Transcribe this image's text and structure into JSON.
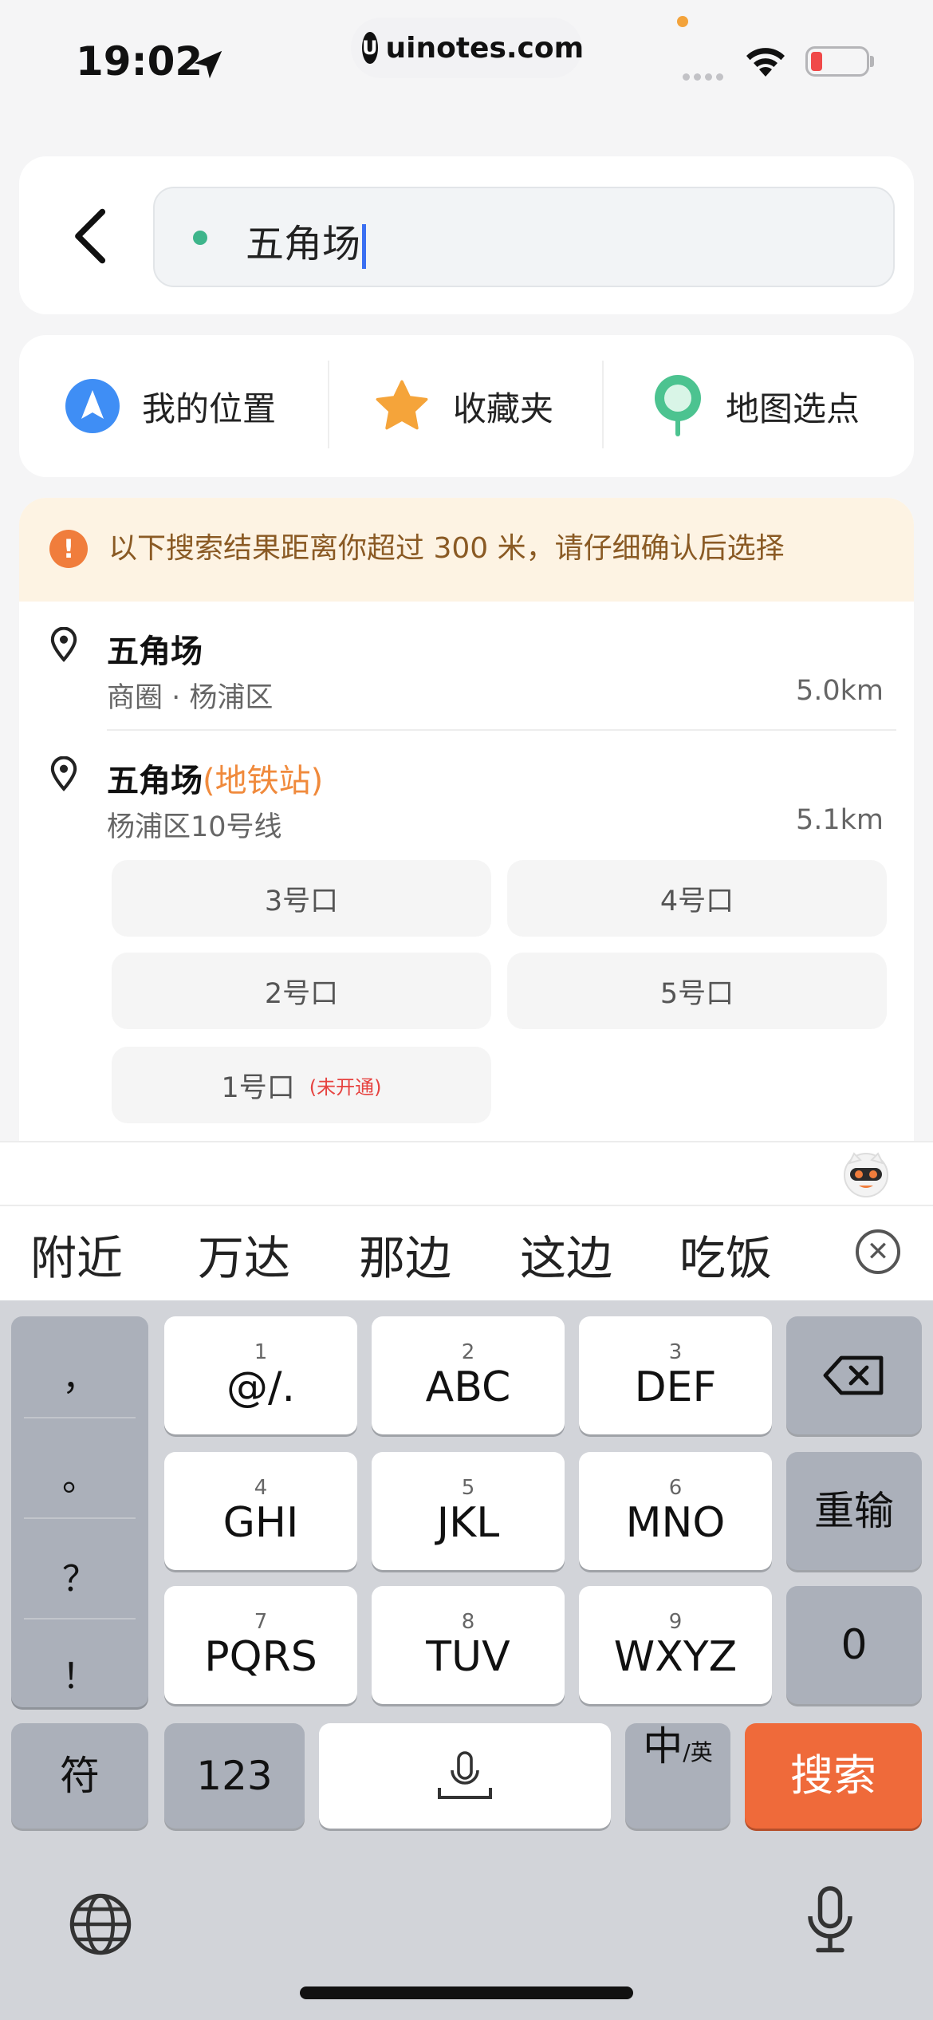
{
  "status_bar": {
    "time": "19:02",
    "url": "uinotes.com",
    "url_logo": "U"
  },
  "search": {
    "back_icon": "chevron-left-icon",
    "query": "五角场"
  },
  "quick_actions": [
    {
      "label": "我的位置",
      "icon": "navigation-arrow-icon",
      "color": "#3f8ef5"
    },
    {
      "label": "收藏夹",
      "icon": "star-icon",
      "color": "#f5a43a"
    },
    {
      "label": "地图选点",
      "icon": "map-pin-icon",
      "color": "#4cc390"
    }
  ],
  "warning": {
    "icon": "!",
    "text": "以下搜索结果距离你超过 300 米，请仔细确认后选择"
  },
  "results": [
    {
      "title": "五角场",
      "title_suffix": "",
      "subtitle": "商圈 · 杨浦区",
      "distance": "5.0km"
    },
    {
      "title": "五角场",
      "title_suffix": "(地铁站)",
      "subtitle": "杨浦区10号线",
      "distance": "5.1km",
      "exits": [
        {
          "label": "3号口",
          "note": ""
        },
        {
          "label": "4号口",
          "note": ""
        },
        {
          "label": "2号口",
          "note": ""
        },
        {
          "label": "5号口",
          "note": ""
        },
        {
          "label": "1号口",
          "note": "(未开通)"
        }
      ]
    }
  ],
  "candidates": [
    "附近",
    "万达",
    "那边",
    "这边",
    "吃饭"
  ],
  "keyboard": {
    "punctuation": [
      "，",
      "。",
      "？",
      "！"
    ],
    "keys": [
      {
        "num": "1",
        "label": "@/."
      },
      {
        "num": "2",
        "label": "ABC"
      },
      {
        "num": "3",
        "label": "DEF"
      },
      {
        "num": "4",
        "label": "GHI"
      },
      {
        "num": "5",
        "label": "JKL"
      },
      {
        "num": "6",
        "label": "MNO"
      },
      {
        "num": "7",
        "label": "PQRS"
      },
      {
        "num": "8",
        "label": "TUV"
      },
      {
        "num": "9",
        "label": "WXYZ"
      }
    ],
    "reset": "重输",
    "zero": "0",
    "symbols": "符",
    "numbers": "123",
    "lang_main": "中",
    "lang_sub": "/英",
    "search": "搜索"
  }
}
